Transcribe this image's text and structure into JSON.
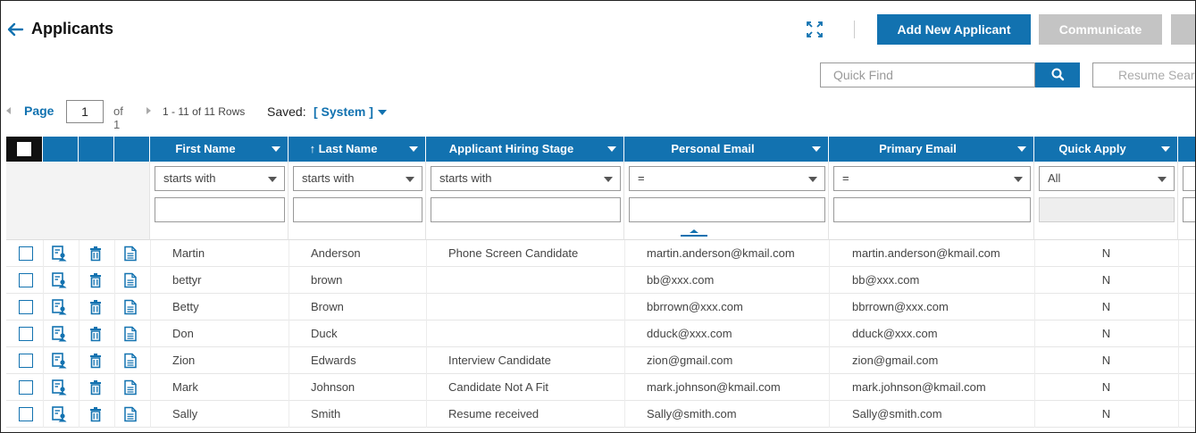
{
  "header": {
    "title": "Applicants",
    "add_button": "Add New Applicant",
    "communicate_button": "Communicate",
    "quick_find_placeholder": "Quick Find",
    "resume_search": "Resume Search"
  },
  "pager": {
    "page_label": "Page",
    "page_value": "1",
    "of_label": "of 1",
    "rows_label": "1 - 11 of 11 Rows",
    "saved_label": "Saved:",
    "saved_value": "[ System ]"
  },
  "columns": [
    {
      "label": "First Name",
      "filter": "starts with"
    },
    {
      "label": "↑ Last Name",
      "filter": "starts with"
    },
    {
      "label": "Applicant Hiring Stage",
      "filter": "starts with"
    },
    {
      "label": "Personal Email",
      "filter": "="
    },
    {
      "label": "Primary Email",
      "filter": "="
    },
    {
      "label": "Quick Apply",
      "filter": "All"
    }
  ],
  "rows": [
    {
      "first": "Martin",
      "last": "Anderson",
      "stage": "Phone Screen Candidate",
      "personal": "martin.anderson@kmail.com",
      "primary": "martin.anderson@kmail.com",
      "quick": "N"
    },
    {
      "first": "bettyr",
      "last": "brown",
      "stage": "",
      "personal": "bb@xxx.com",
      "primary": "bb@xxx.com",
      "quick": "N"
    },
    {
      "first": "Betty",
      "last": "Brown",
      "stage": "",
      "personal": "bbrrown@xxx.com",
      "primary": "bbrrown@xxx.com",
      "quick": "N"
    },
    {
      "first": "Don",
      "last": "Duck",
      "stage": "",
      "personal": "dduck@xxx.com",
      "primary": "dduck@xxx.com",
      "quick": "N"
    },
    {
      "first": "Zion",
      "last": "Edwards",
      "stage": "Interview Candidate",
      "personal": "zion@gmail.com",
      "primary": "zion@gmail.com",
      "quick": "N"
    },
    {
      "first": "Mark",
      "last": "Johnson",
      "stage": "Candidate Not A Fit",
      "personal": "mark.johnson@kmail.com",
      "primary": "mark.johnson@kmail.com",
      "quick": "N"
    },
    {
      "first": "Sally",
      "last": "Smith",
      "stage": "Resume received",
      "personal": "Sally@smith.com",
      "primary": "Sally@smith.com",
      "quick": "N"
    }
  ],
  "colors": {
    "accent": "#1272b0",
    "disabled": "#c4c4c4"
  }
}
